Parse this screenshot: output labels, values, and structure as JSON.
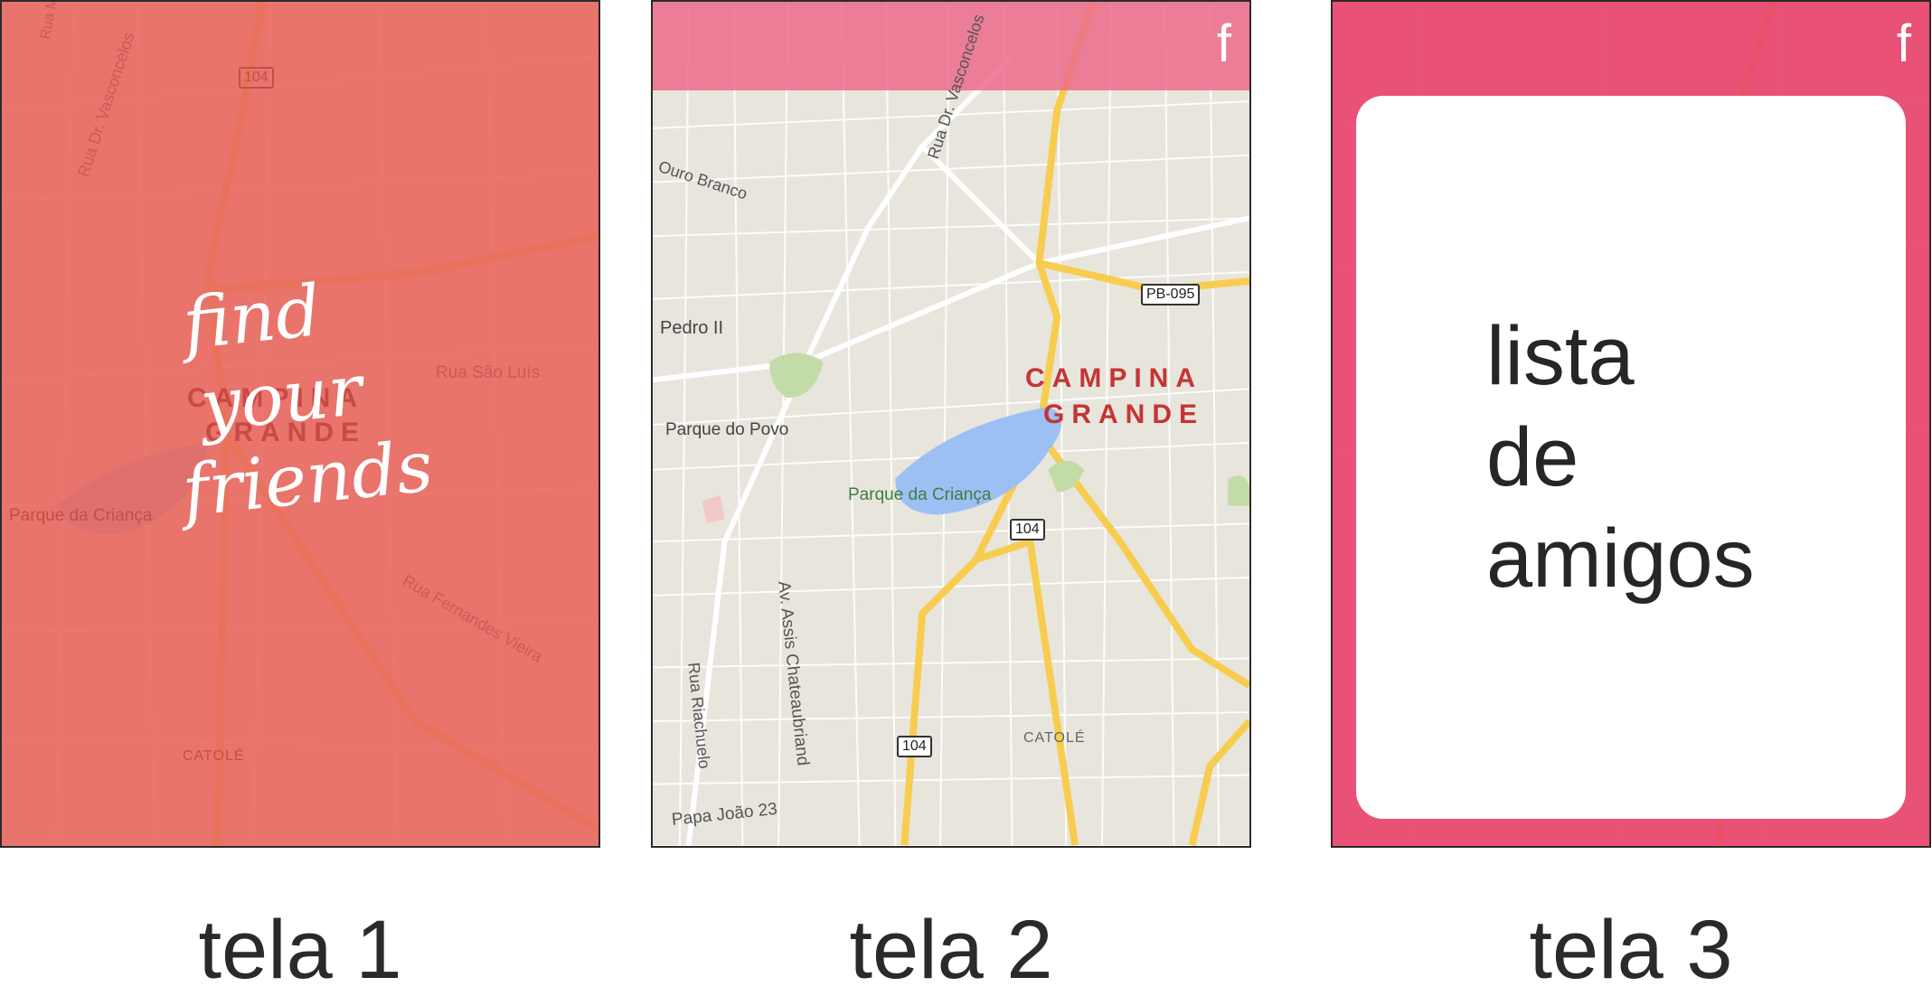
{
  "screens": [
    {
      "caption": "tela 1",
      "tagline": [
        "find",
        "your",
        "friends"
      ],
      "map_labels": {
        "city_line1": "CAMPINA",
        "city_line2": "GRANDE",
        "park": "Parque da Criança",
        "district": "CATOLÉ",
        "road_shield": "104",
        "street1": "Rua Manoel",
        "street2": "Rua Dr. Vasconcelos",
        "street3": "Rua São Luís",
        "street4": "Rua Fernandes Vieira"
      },
      "overlay_color": "#e8685f"
    },
    {
      "caption": "tela 2",
      "facebook_icon": "f",
      "map_labels": {
        "city_line1": "CAMPINA",
        "city_line2": "GRANDE",
        "park1": "Parque da Criança",
        "park2": "Parque do Povo",
        "district": "CATOLÉ",
        "road_shield": "104",
        "road_pb": "PB-095",
        "street1": "Rua Dr. Vasconcelos",
        "street2": "Ouro Branco",
        "street3": "Pedro II",
        "street4": "Av. Assis Chateaubriand",
        "street5": "Rua Riachuelo",
        "street6": "Papa João 23"
      },
      "topbar_color": "#ec6b8b"
    },
    {
      "caption": "tela 3",
      "facebook_icon": "f",
      "card_text": [
        "lista",
        "de",
        "amigos"
      ],
      "overlay_color": "#e8466e"
    }
  ]
}
